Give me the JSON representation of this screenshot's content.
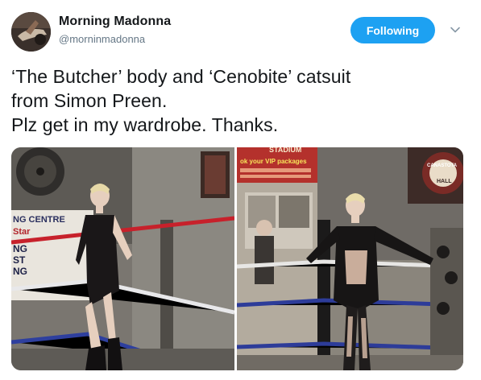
{
  "author": {
    "name": "Morning Madonna",
    "handle": "@morninmadonna",
    "avatar_icon": "avatar-photo"
  },
  "follow_button": {
    "label": "Following",
    "color": "#1da1f2"
  },
  "menu_icon": "chevron-down-icon",
  "tweet": {
    "lines": [
      "‘The Butcher’ body and ‘Cenobite’ catsuit",
      "from Simon Preen.",
      "Plz get in my wardrobe. Thanks."
    ]
  },
  "media": {
    "photo1": {
      "banner_lines": [
        "NG CENTRE",
        "Star",
        "NG",
        "ST",
        "NG"
      ]
    },
    "photo2": {
      "sign_lines": [
        "STADIUM",
        "ok your VIP packages"
      ],
      "emblem_lines": [
        "CANASTOTA",
        "HALL"
      ]
    }
  }
}
